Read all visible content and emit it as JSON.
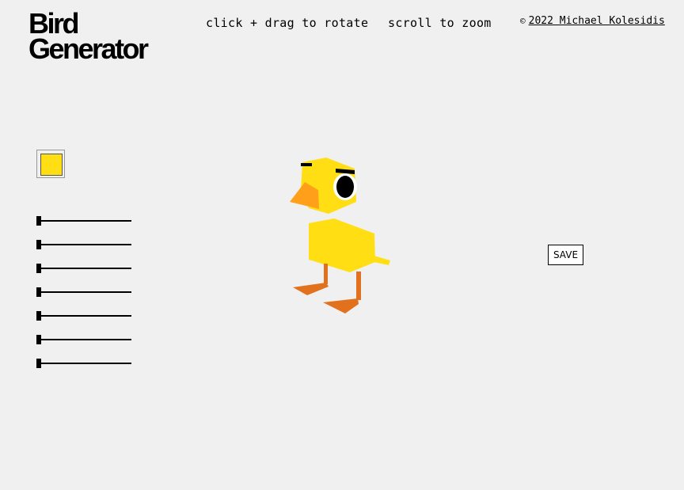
{
  "header": {
    "title_line1": "Bird",
    "title_line2": "Generator",
    "hint_rotate": "click + drag to rotate",
    "hint_zoom": "scroll to zoom",
    "copyright_symbol": "©",
    "credit_link": "2022 Michael Kolesidis"
  },
  "controls": {
    "color": "#ffde14",
    "sliders": [
      {
        "name": "slider-1",
        "value": 0
      },
      {
        "name": "slider-2",
        "value": 0
      },
      {
        "name": "slider-3",
        "value": 0
      },
      {
        "name": "slider-4",
        "value": 0
      },
      {
        "name": "slider-5",
        "value": 0
      },
      {
        "name": "slider-6",
        "value": 0
      },
      {
        "name": "slider-7",
        "value": 0
      }
    ],
    "save_label": "SAVE"
  },
  "bird": {
    "body_color": "#ffde14",
    "beak_color": "#ff9f1a",
    "legs_color": "#e2711d",
    "eye_color": "#000000"
  }
}
